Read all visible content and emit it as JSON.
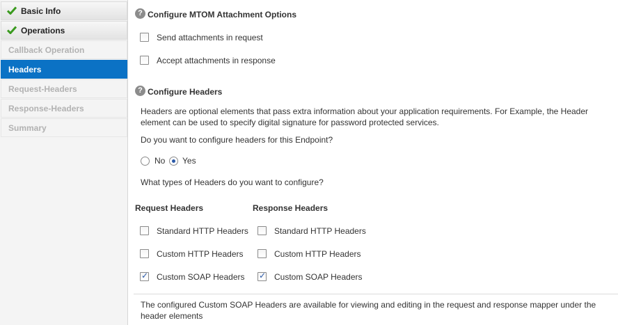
{
  "sidebar": {
    "items": [
      {
        "label": "Basic Info",
        "state": "done"
      },
      {
        "label": "Operations",
        "state": "done"
      },
      {
        "label": "Callback Operation",
        "state": "disabled"
      },
      {
        "label": "Headers",
        "state": "active"
      },
      {
        "label": "Request-Headers",
        "state": "disabled"
      },
      {
        "label": "Response-Headers",
        "state": "disabled"
      },
      {
        "label": "Summary",
        "state": "disabled"
      }
    ]
  },
  "mtom": {
    "title": "Configure MTOM Attachment Options",
    "send_label": "Send attachments in request",
    "send_checked": false,
    "accept_label": "Accept attachments in response",
    "accept_checked": false
  },
  "headers": {
    "title": "Configure Headers",
    "description": "Headers are optional elements that pass extra information about your application requirements. For Example, the Header element can be used to specify digital signature for password protected services.",
    "question": "Do you want to configure headers for this Endpoint?",
    "no_label": "No",
    "yes_label": "Yes",
    "selected": "Yes",
    "types_question": "What types of Headers do you want to configure?",
    "request_title": "Request Headers",
    "response_title": "Response Headers",
    "request_options": [
      {
        "label": "Standard HTTP Headers",
        "checked": false
      },
      {
        "label": "Custom HTTP Headers",
        "checked": false
      },
      {
        "label": "Custom SOAP Headers",
        "checked": true
      }
    ],
    "response_options": [
      {
        "label": "Standard HTTP Headers",
        "checked": false
      },
      {
        "label": "Custom HTTP Headers",
        "checked": false
      },
      {
        "label": "Custom SOAP Headers",
        "checked": true
      }
    ],
    "footer_note": "The configured Custom SOAP Headers are available for viewing and editing in the request and response mapper under the header elements"
  },
  "colors": {
    "active_nav": "#0b72c5",
    "check_green": "#3a9a1e"
  }
}
